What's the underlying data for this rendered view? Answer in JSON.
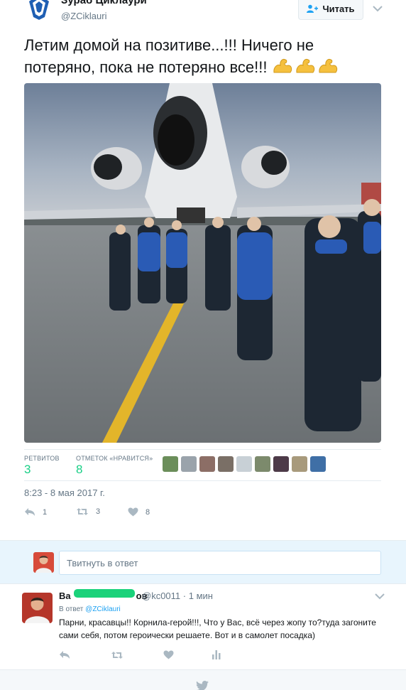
{
  "header": {
    "author_name": "Зураб Циклаури",
    "author_handle": "@ZCiklauri",
    "follow_label": "Читать"
  },
  "tweet": {
    "text": "Летим домой на позитиве...!!! Ничего не потеряно, пока не потеряно все!!!",
    "emoji": [
      "flexed-biceps",
      "flexed-biceps",
      "flexed-biceps"
    ],
    "photo_description": "team walking to airplane on tarmac"
  },
  "stats": {
    "retweets_label": "РЕТВИТОВ",
    "retweets_value": "3",
    "likes_label": "ОТМЕТОК «НРАВИТСЯ»",
    "likes_value": "8",
    "liker_avatar_colors": [
      "#6b8e5a",
      "#9aa3ab",
      "#8c6e66",
      "#7a6f66",
      "#c8d0d6",
      "#7c8a6c",
      "#4d3a48",
      "#a89a7c",
      "#3f6fa6"
    ]
  },
  "timestamp": "8:23 - 8 мая 2017 г.",
  "actions": {
    "reply_count": "1",
    "retweet_count": "3",
    "like_count": "8"
  },
  "reply_box": {
    "placeholder": "Твитнуть в ответ"
  },
  "comment": {
    "name_visible_start": "Ва",
    "name_visible_end": "ов",
    "handle": "@kc0011",
    "time": "· 1 мин",
    "in_reply_prefix": "В ответ",
    "in_reply_handle": "@ZCiklauri",
    "text": "Парни, красавцы!! Корнила-герой!!!, Что у Вас, всё через жопу то?туда загоните сами себя, потом героически решаете. Вот и в самолет посадка)"
  },
  "colors": {
    "accent": "#1da1f2",
    "count_green": "#19cf86",
    "reply_bg": "#e8f5fd"
  }
}
